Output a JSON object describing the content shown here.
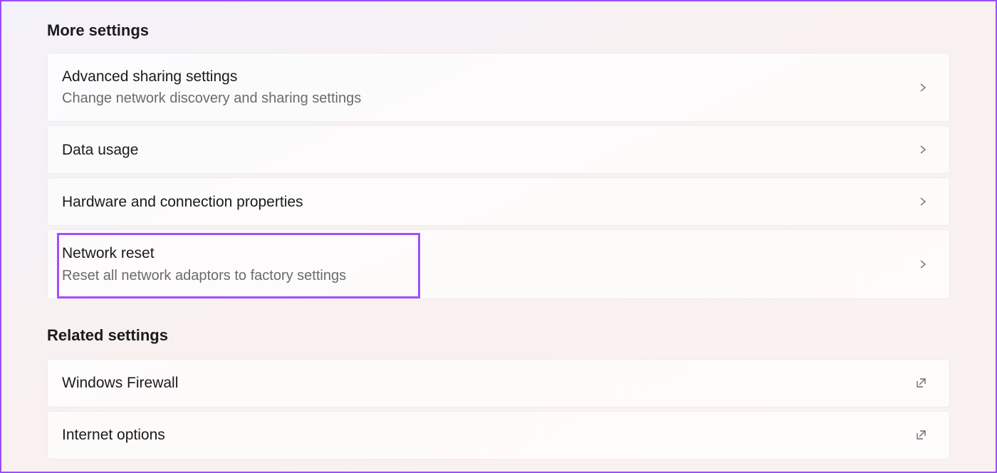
{
  "sections": {
    "more_settings": {
      "header": "More settings",
      "items": [
        {
          "title": "Advanced sharing settings",
          "subtitle": "Change network discovery and sharing settings",
          "icon": "chevron"
        },
        {
          "title": "Data usage",
          "subtitle": "",
          "icon": "chevron"
        },
        {
          "title": "Hardware and connection properties",
          "subtitle": "",
          "icon": "chevron"
        },
        {
          "title": "Network reset",
          "subtitle": "Reset all network adaptors to factory settings",
          "icon": "chevron"
        }
      ]
    },
    "related_settings": {
      "header": "Related settings",
      "items": [
        {
          "title": "Windows Firewall",
          "subtitle": "",
          "icon": "external"
        },
        {
          "title": "Internet options",
          "subtitle": "",
          "icon": "external"
        }
      ]
    }
  }
}
